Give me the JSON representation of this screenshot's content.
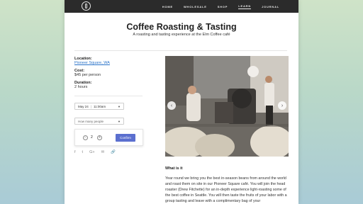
{
  "header": {
    "logo_icon": "coffee-bean-logo-icon",
    "nav": [
      {
        "label": "HOME"
      },
      {
        "label": "WHOLESALE"
      },
      {
        "label": "SHOP"
      },
      {
        "label": "LEARN",
        "active": true
      },
      {
        "label": "JOURNAL"
      }
    ]
  },
  "page": {
    "title": "Coffee Roasting & Tasting",
    "subtitle": "A roasting and tasting experience at the Elm Coffee café"
  },
  "details": {
    "location_label": "Location:",
    "location_value": "Pioneer Square, WA",
    "cost_label": "Cost:",
    "cost_value": "$45 per person",
    "duration_label": "Duration:",
    "duration_value": "2 hours"
  },
  "booking": {
    "date": "May 24",
    "time": "11:00am",
    "people_placeholder": "How many people",
    "quantity": "2",
    "minus_label": "−",
    "plus_label": "+",
    "confirm_label": "Confirm"
  },
  "share": {
    "icons": [
      "facebook-icon",
      "twitter-icon",
      "google-plus-icon",
      "email-icon",
      "link-icon"
    ],
    "glyphs": [
      "f",
      "t",
      "G+",
      "✉",
      "🔗"
    ]
  },
  "gallery": {
    "prev_label": "‹",
    "next_label": "›"
  },
  "about": {
    "heading": "What is it",
    "body": "Year round we bring you the best in-season beans from around the world and roast them on site in our Pioneer Square café. You will join the head roaster (Drew Fitchette) for an in-depth experience light-roasting some of the best coffee in Seattle. You will then taste the fruits of your labor with a group tasting and leave with a complimentary bag of your"
  },
  "colors": {
    "accent": "#5b6fcf",
    "link": "#2a73c9",
    "topbar": "#2b2b2b"
  }
}
